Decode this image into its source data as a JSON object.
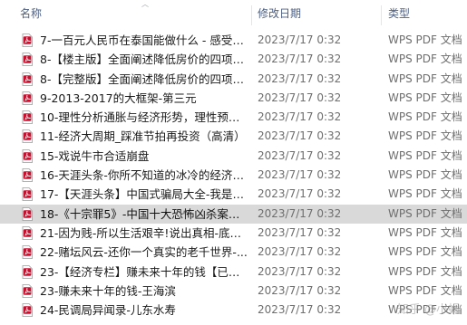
{
  "columns": {
    "name": "名称",
    "date": "修改日期",
    "type": "类型"
  },
  "icon": "wps-pdf-file-icon",
  "accent": "#c8102e",
  "files": [
    {
      "name": "7-一百元人民币在泰国能做什么 - 感受泰...",
      "date": "2023/7/17 0:32",
      "type": "WPS PDF 文档",
      "selected": false
    },
    {
      "name": "8-【楼主版】全面阐述降低房价的四项基...",
      "date": "2023/7/17 0:32",
      "type": "WPS PDF 文档",
      "selected": false
    },
    {
      "name": "8-【完整版】全面阐述降低房价的四项基...",
      "date": "2023/7/17 0:32",
      "type": "WPS PDF 文档",
      "selected": false
    },
    {
      "name": "9-2013-2017的大框架-第三元",
      "date": "2023/7/17 0:32",
      "type": "WPS PDF 文档",
      "selected": false
    },
    {
      "name": "10-理性分析通胀与经济形势，理性预测...",
      "date": "2023/7/17 0:32",
      "type": "WPS PDF 文档",
      "selected": false
    },
    {
      "name": "11-经济大周期_踩准节拍再投资（高清）",
      "date": "2023/7/17 0:32",
      "type": "WPS PDF 文档",
      "selected": false
    },
    {
      "name": "15-戏说牛市合适崩盘",
      "date": "2023/7/17 0:32",
      "type": "WPS PDF 文档",
      "selected": false
    },
    {
      "name": "16-天涯头条-你所不知道的冰冷的经济真...",
      "date": "2023/7/17 0:32",
      "type": "WPS PDF 文档",
      "selected": false
    },
    {
      "name": "17-【天涯头条】中国式骗局大全-我是骗...",
      "date": "2023/7/17 0:32",
      "type": "WPS PDF 文档",
      "selected": false
    },
    {
      "name": "18-《十宗罪5》-中国十大恐怖凶杀案》-...",
      "date": "2023/7/17 0:32",
      "type": "WPS PDF 文档",
      "selected": true
    },
    {
      "name": "21-因为贱-所以生活艰辛!说出真相-底层...",
      "date": "2023/7/17 0:32",
      "type": "WPS PDF 文档",
      "selected": false
    },
    {
      "name": "22-赌坛风云-还你一个真实的老千世界-...",
      "date": "2023/7/17 0:32",
      "type": "WPS PDF 文档",
      "selected": false
    },
    {
      "name": "23-【经济专栏】赚未来十年的钱【已出...",
      "date": "2023/7/17 0:32",
      "type": "WPS PDF 文档",
      "selected": false
    },
    {
      "name": "23-赚未来十年的钱-王海滨",
      "date": "2023/7/17 0:32",
      "type": "WPS PDF 文档",
      "selected": false
    },
    {
      "name": "24-民调局异闻录-儿东水寿",
      "date": "2023/7/17 0:32",
      "type": "WPS PDF 文档",
      "selected": false
    }
  ],
  "watermark": "知乎 @小蜗"
}
